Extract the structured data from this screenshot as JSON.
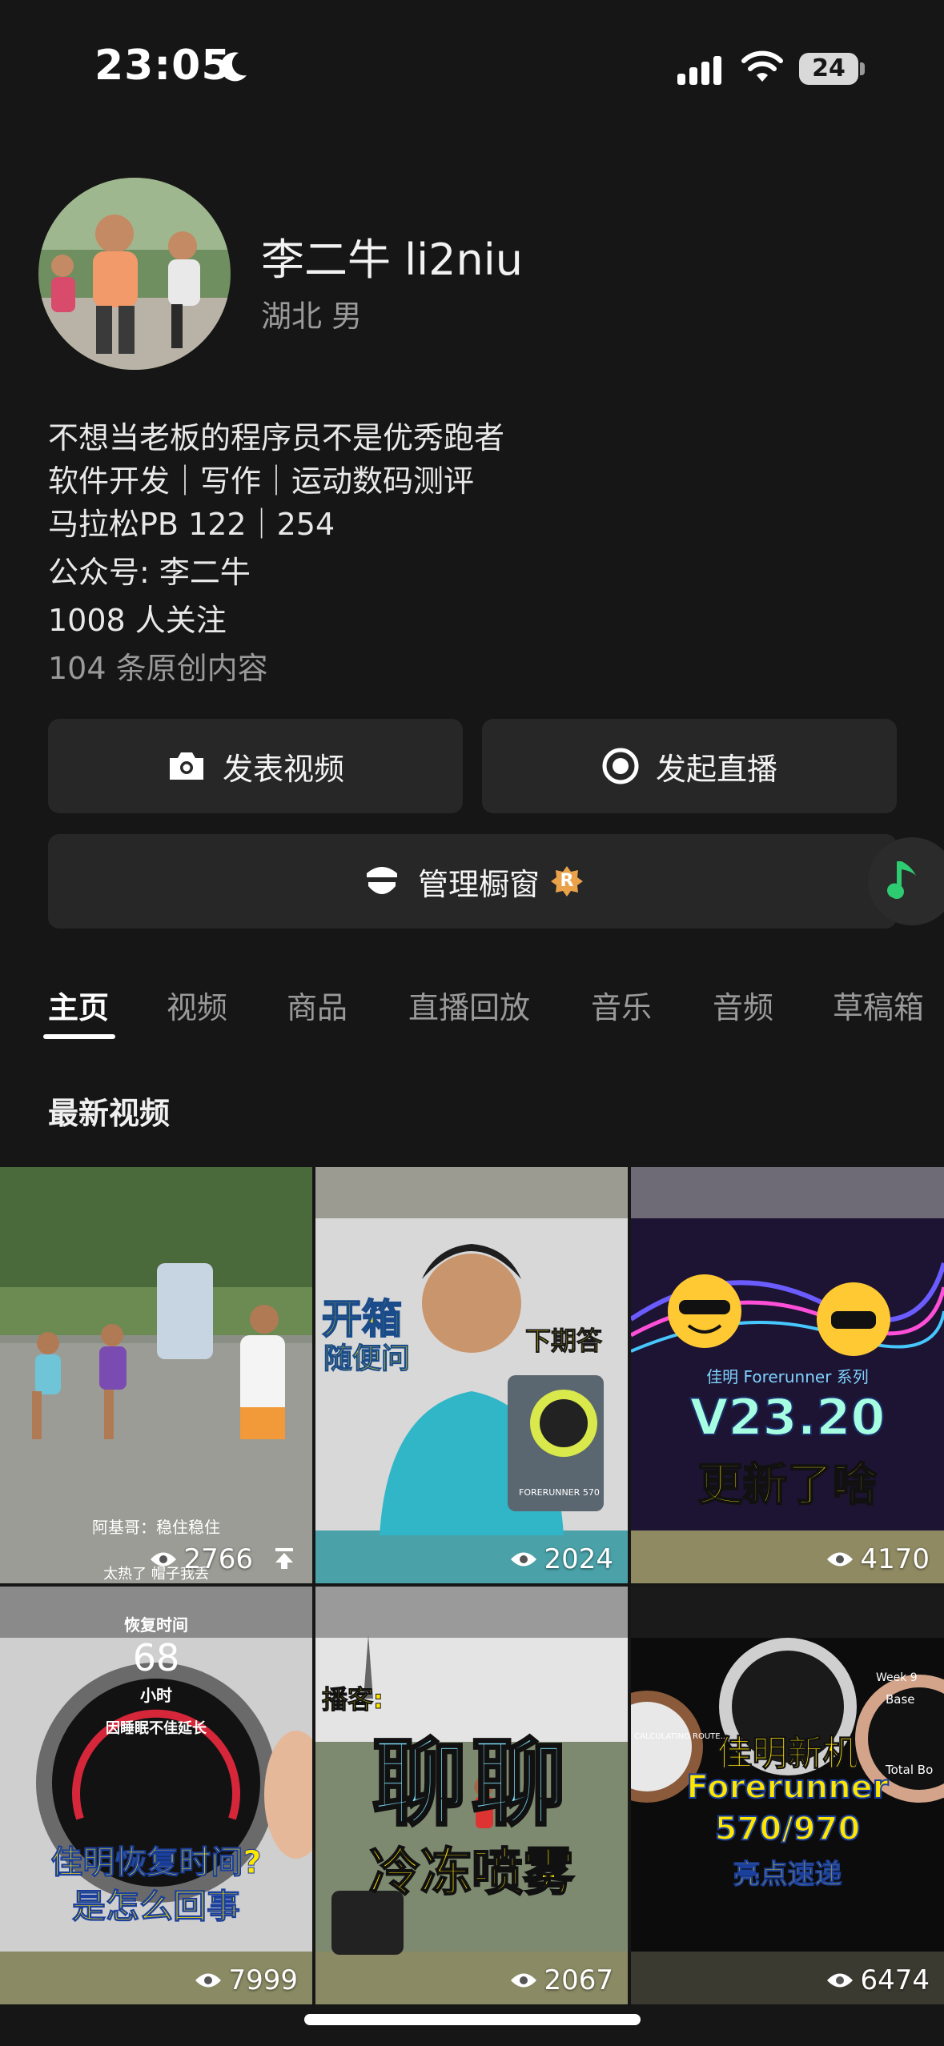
{
  "status_bar": {
    "time": "23:05",
    "battery": "24"
  },
  "profile": {
    "username": "李二牛 li2niu",
    "location": "湖北 男",
    "bio": [
      "不想当老板的程序员不是优秀跑者",
      "软件开发｜写作｜运动数码测评",
      "马拉松PB 122｜254",
      "公众号: 李二牛"
    ],
    "followers": "1008 人关注",
    "originals": "104 条原创内容"
  },
  "actions": {
    "post_video": "发表视频",
    "go_live": "发起直播",
    "manage_showcase": "管理橱窗",
    "showcase_badge": "R"
  },
  "tabs": [
    "主页",
    "视频",
    "商品",
    "直播回放",
    "音乐",
    "音频",
    "草稿箱"
  ],
  "section_title": "最新视频",
  "videos": [
    {
      "views": "2766",
      "pinned": true,
      "caption_top": "阿基哥：稳住稳住",
      "caption_bottom": "太热了 帽子我丢"
    },
    {
      "views": "2024",
      "text_a": "开箱",
      "text_b": "随便问",
      "text_c": "下期答",
      "watch_label": "FORERUNNER 570"
    },
    {
      "views": "4170",
      "subtitle": "佳明 Forerunner 系列",
      "headline": "V23.20",
      "tagline": "更新了啥"
    },
    {
      "views": "7999",
      "watch_title": "恢复时间",
      "watch_value": "68",
      "watch_unit": "小时",
      "watch_note": "因睡眠不佳延长",
      "line1": "佳明恢复时间?",
      "line2": "是怎么回事"
    },
    {
      "views": "2067",
      "tag": "播客:",
      "big": "聊聊",
      "line": "冷冻喷雾"
    },
    {
      "views": "6474",
      "line1": "佳明新机",
      "line2": "Forerunner",
      "line3": "570/970",
      "line4": "亮点速递",
      "side_a": "CALCULATING ROUTE...",
      "side_b": "Base",
      "side_c": "Total Bo",
      "side_d": "Week 9"
    }
  ],
  "colors": {
    "background": "#161616",
    "button": "#272727",
    "muted_text": "#9a9a9a",
    "accent_yellow": "#ffd400"
  }
}
